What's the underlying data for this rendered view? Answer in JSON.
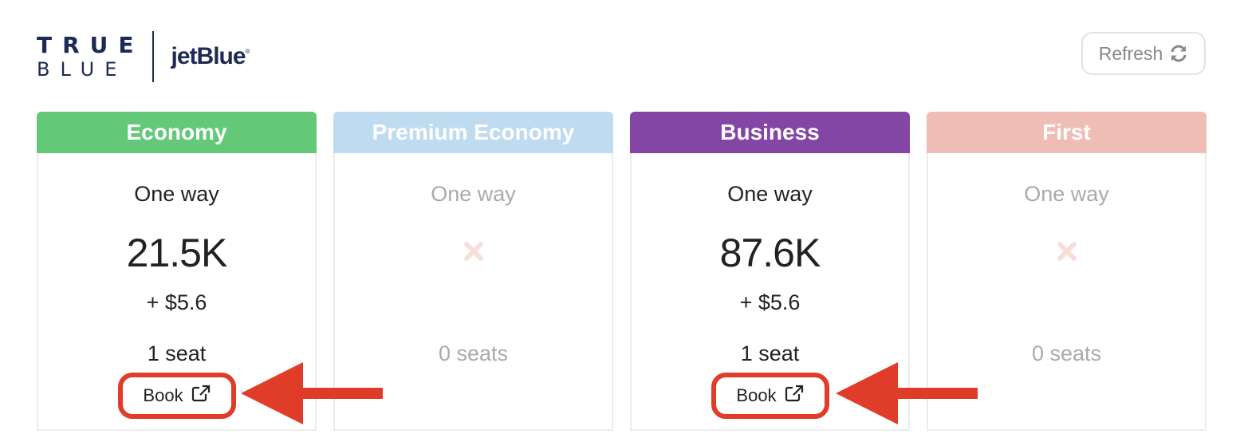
{
  "header": {
    "logo_top": "TRUE",
    "logo_bottom": "BLUE",
    "partner": "jetBlue",
    "partner_mark": "®"
  },
  "toolbar": {
    "refresh_label": "Refresh",
    "refresh_icon": "refresh-icon"
  },
  "cards": [
    {
      "title": "Economy",
      "color": "#63c878",
      "available": true,
      "trip": "One way",
      "points": "21.5K",
      "fee": "+ $5.6",
      "seats": "1 seat",
      "book_label": "Book"
    },
    {
      "title": "Premium Economy",
      "color": "#bfdbef",
      "available": false,
      "trip": "One way",
      "seats": "0 seats",
      "unavailable_icon": "cross-icon"
    },
    {
      "title": "Business",
      "color": "#8446a4",
      "available": true,
      "trip": "One way",
      "points": "87.6K",
      "fee": "+ $5.6",
      "seats": "1 seat",
      "book_label": "Book"
    },
    {
      "title": "First",
      "color": "#f0bdb5",
      "available": false,
      "trip": "One way",
      "seats": "0 seats",
      "unavailable_icon": "cross-icon"
    }
  ],
  "colors": {
    "highlight": "#e03c2a",
    "brand": "#1c2a55",
    "muted_text": "#aaaaaa",
    "cross": "#f7dedb"
  }
}
